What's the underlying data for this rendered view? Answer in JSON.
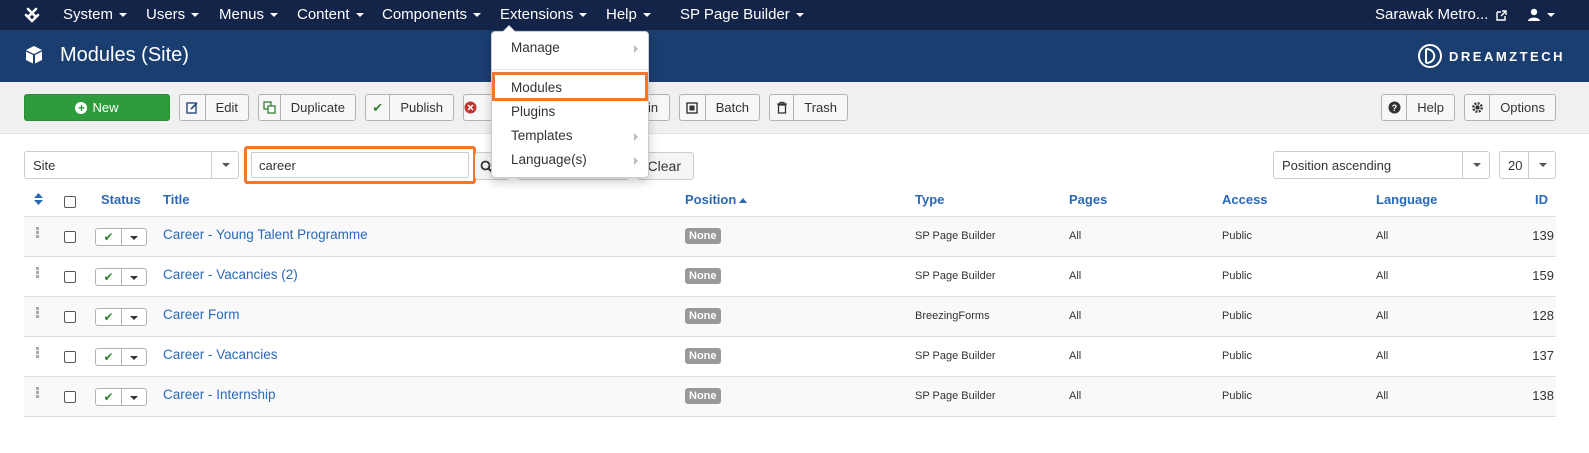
{
  "nav": {
    "items": [
      {
        "label": "System"
      },
      {
        "label": "Users"
      },
      {
        "label": "Menus"
      },
      {
        "label": "Content"
      },
      {
        "label": "Components"
      },
      {
        "label": "Extensions"
      },
      {
        "label": "Help"
      },
      {
        "label": "SP Page Builder"
      }
    ],
    "site_link": "Sarawak Metro...",
    "bg_color": "#132448"
  },
  "extensions_menu": {
    "items": [
      {
        "label": "Manage",
        "has_sub": true
      },
      {
        "label": "Modules",
        "has_sub": false,
        "highlighted": true
      },
      {
        "label": "Plugins",
        "has_sub": false
      },
      {
        "label": "Templates",
        "has_sub": true
      },
      {
        "label": "Language(s)",
        "has_sub": true
      }
    ]
  },
  "header": {
    "title": "Modules (Site)",
    "brand": "DREAMZTECH",
    "bg_color": "#1b3e70"
  },
  "toolbar": {
    "new_label": "New",
    "edit_label": "Edit",
    "duplicate_label": "Duplicate",
    "publish_label": "Publish",
    "unpublish_label": "",
    "checkin_label": "in",
    "batch_label": "Batch",
    "trash_label": "Trash",
    "help_label": "Help",
    "options_label": "Options"
  },
  "filters": {
    "client": "Site",
    "search_value": "career",
    "clear_label": "Clear",
    "sort": "Position ascending",
    "limit": "20"
  },
  "table": {
    "headers": {
      "status": "Status",
      "title": "Title",
      "position": "Position",
      "type": "Type",
      "pages": "Pages",
      "access": "Access",
      "language": "Language",
      "id": "ID"
    },
    "rows": [
      {
        "title": "Career - Young Talent Programme",
        "position": "None",
        "type": "SP Page Builder",
        "pages": "All",
        "access": "Public",
        "language": "All",
        "id": "139"
      },
      {
        "title": "Career - Vacancies (2)",
        "position": "None",
        "type": "SP Page Builder",
        "pages": "All",
        "access": "Public",
        "language": "All",
        "id": "159"
      },
      {
        "title": "Career Form",
        "position": "None",
        "type": "BreezingForms",
        "pages": "All",
        "access": "Public",
        "language": "All",
        "id": "128"
      },
      {
        "title": "Career - Vacancies",
        "position": "None",
        "type": "SP Page Builder",
        "pages": "All",
        "access": "Public",
        "language": "All",
        "id": "137"
      },
      {
        "title": "Career - Internship",
        "position": "None",
        "type": "SP Page Builder",
        "pages": "All",
        "access": "Public",
        "language": "All",
        "id": "138"
      }
    ]
  },
  "colors": {
    "highlight": "#f2762e",
    "link": "#2a69b8",
    "new_button": "#2e9b3c"
  }
}
